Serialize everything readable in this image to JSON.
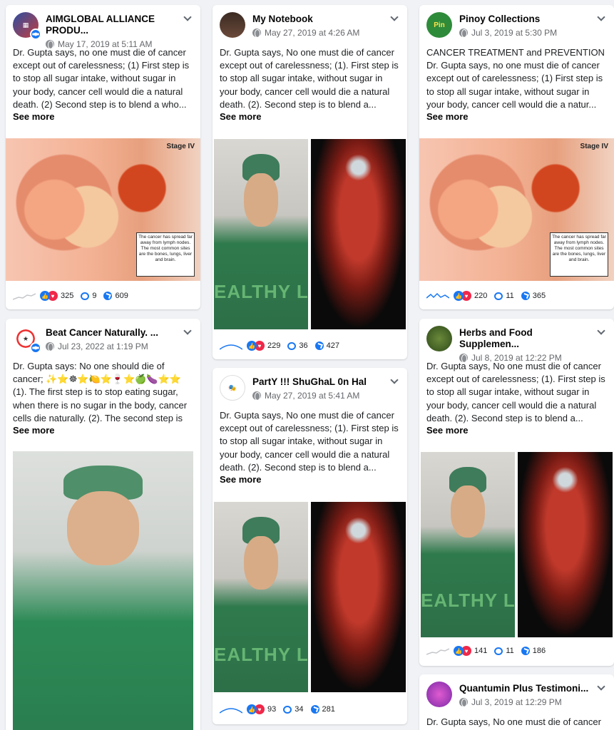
{
  "posts": [
    {
      "author": "AIMGLOBAL ALLIANCE PRODU...",
      "date": "May 17, 2019 at 5:11 AM",
      "text": "Dr. Gupta says, no one must die of cancer except out of carelessness; (1) First step is to stop all sugar intake, without sugar in your body, cancer cell would die a natural death. (2) Second step is to blend a who...",
      "see_more": "See more",
      "image": {
        "stage_label": "Stage IV",
        "caption": "The cancer has spread far away from lymph nodes. The most common sites are the bones, lungs, liver and brain."
      },
      "reactions": "325",
      "comments": "9",
      "shares": "609"
    },
    {
      "author": "Beat Cancer Naturally. ...",
      "date": "Jul 23, 2022 at 1:19 PM",
      "text": "Dr. Gupta says: No one should die of cancer; ✨⭐☸⭐🍋⭐🍷⭐🍏🍆⭐⭐ (1). The first step is to stop eating sugar, when there is no sugar in the body, cancer cells die naturally. (2). The second step is a...",
      "see_more": "See more"
    },
    {
      "author": "My Notebook",
      "date": "May 27, 2019 at 4:26 AM",
      "text": "Dr. Gupta says, No one must die of cancer except out of carelessness; (1). First step is to stop all sugar intake, without sugar in your body, cancer cell would die a natural death. (2). Second step is to blend a...",
      "see_more": "See more",
      "image": {
        "watermark": "EALTHY L"
      },
      "reactions": "229",
      "comments": "36",
      "shares": "427"
    },
    {
      "author": "PartY !!! ShuGhaL 0n Hal",
      "date": "May 27, 2019 at 5:41 AM",
      "text": "Dr. Gupta says, No one must die of cancer except out of carelessness; (1). First step is to stop all sugar intake, without sugar in your body, cancer cell would die a natural death. (2). Second step is to blend a...",
      "see_more": "See more",
      "image": {
        "watermark": "EALTHY L"
      },
      "reactions": "93",
      "comments": "34",
      "shares": "281"
    },
    {
      "author": "Pinoy Collections",
      "date": "Jul 3, 2019 at 5:30 PM",
      "text": "CANCER TREATMENT and PREVENTION Dr. Gupta says, no one must die of cancer except out of carelessness; (1) First step is to stop all sugar intake, without sugar in your body, cancer cell would die a natur...",
      "see_more": "See more",
      "image": {
        "stage_label": "Stage IV",
        "caption": "The cancer has spread far away from lymph nodes. The most common sites are the bones, lungs, liver and brain."
      },
      "reactions": "220",
      "comments": "11",
      "shares": "365"
    },
    {
      "author": "Herbs and Food Supplemen...",
      "date": "Jul 8, 2019 at 12:22 PM",
      "text": "Dr. Gupta says, No one must die of cancer except out of carelessness; (1). First step is to stop all sugar intake, without sugar in your body, cancer cell would die a natural death. (2). Second step is to blend a...",
      "see_more": "See more",
      "image": {
        "watermark": "EALTHY L"
      },
      "reactions": "141",
      "comments": "11",
      "shares": "186"
    },
    {
      "author": "Quantumin Plus Testimoni...",
      "date": "Jul 3, 2019 at 12:29 PM",
      "text": "Dr. Gupta says, No one must die of cancer"
    }
  ],
  "colors": {
    "brand": "#1877f2",
    "love": "#f02849",
    "background": "#f0f2f5"
  }
}
